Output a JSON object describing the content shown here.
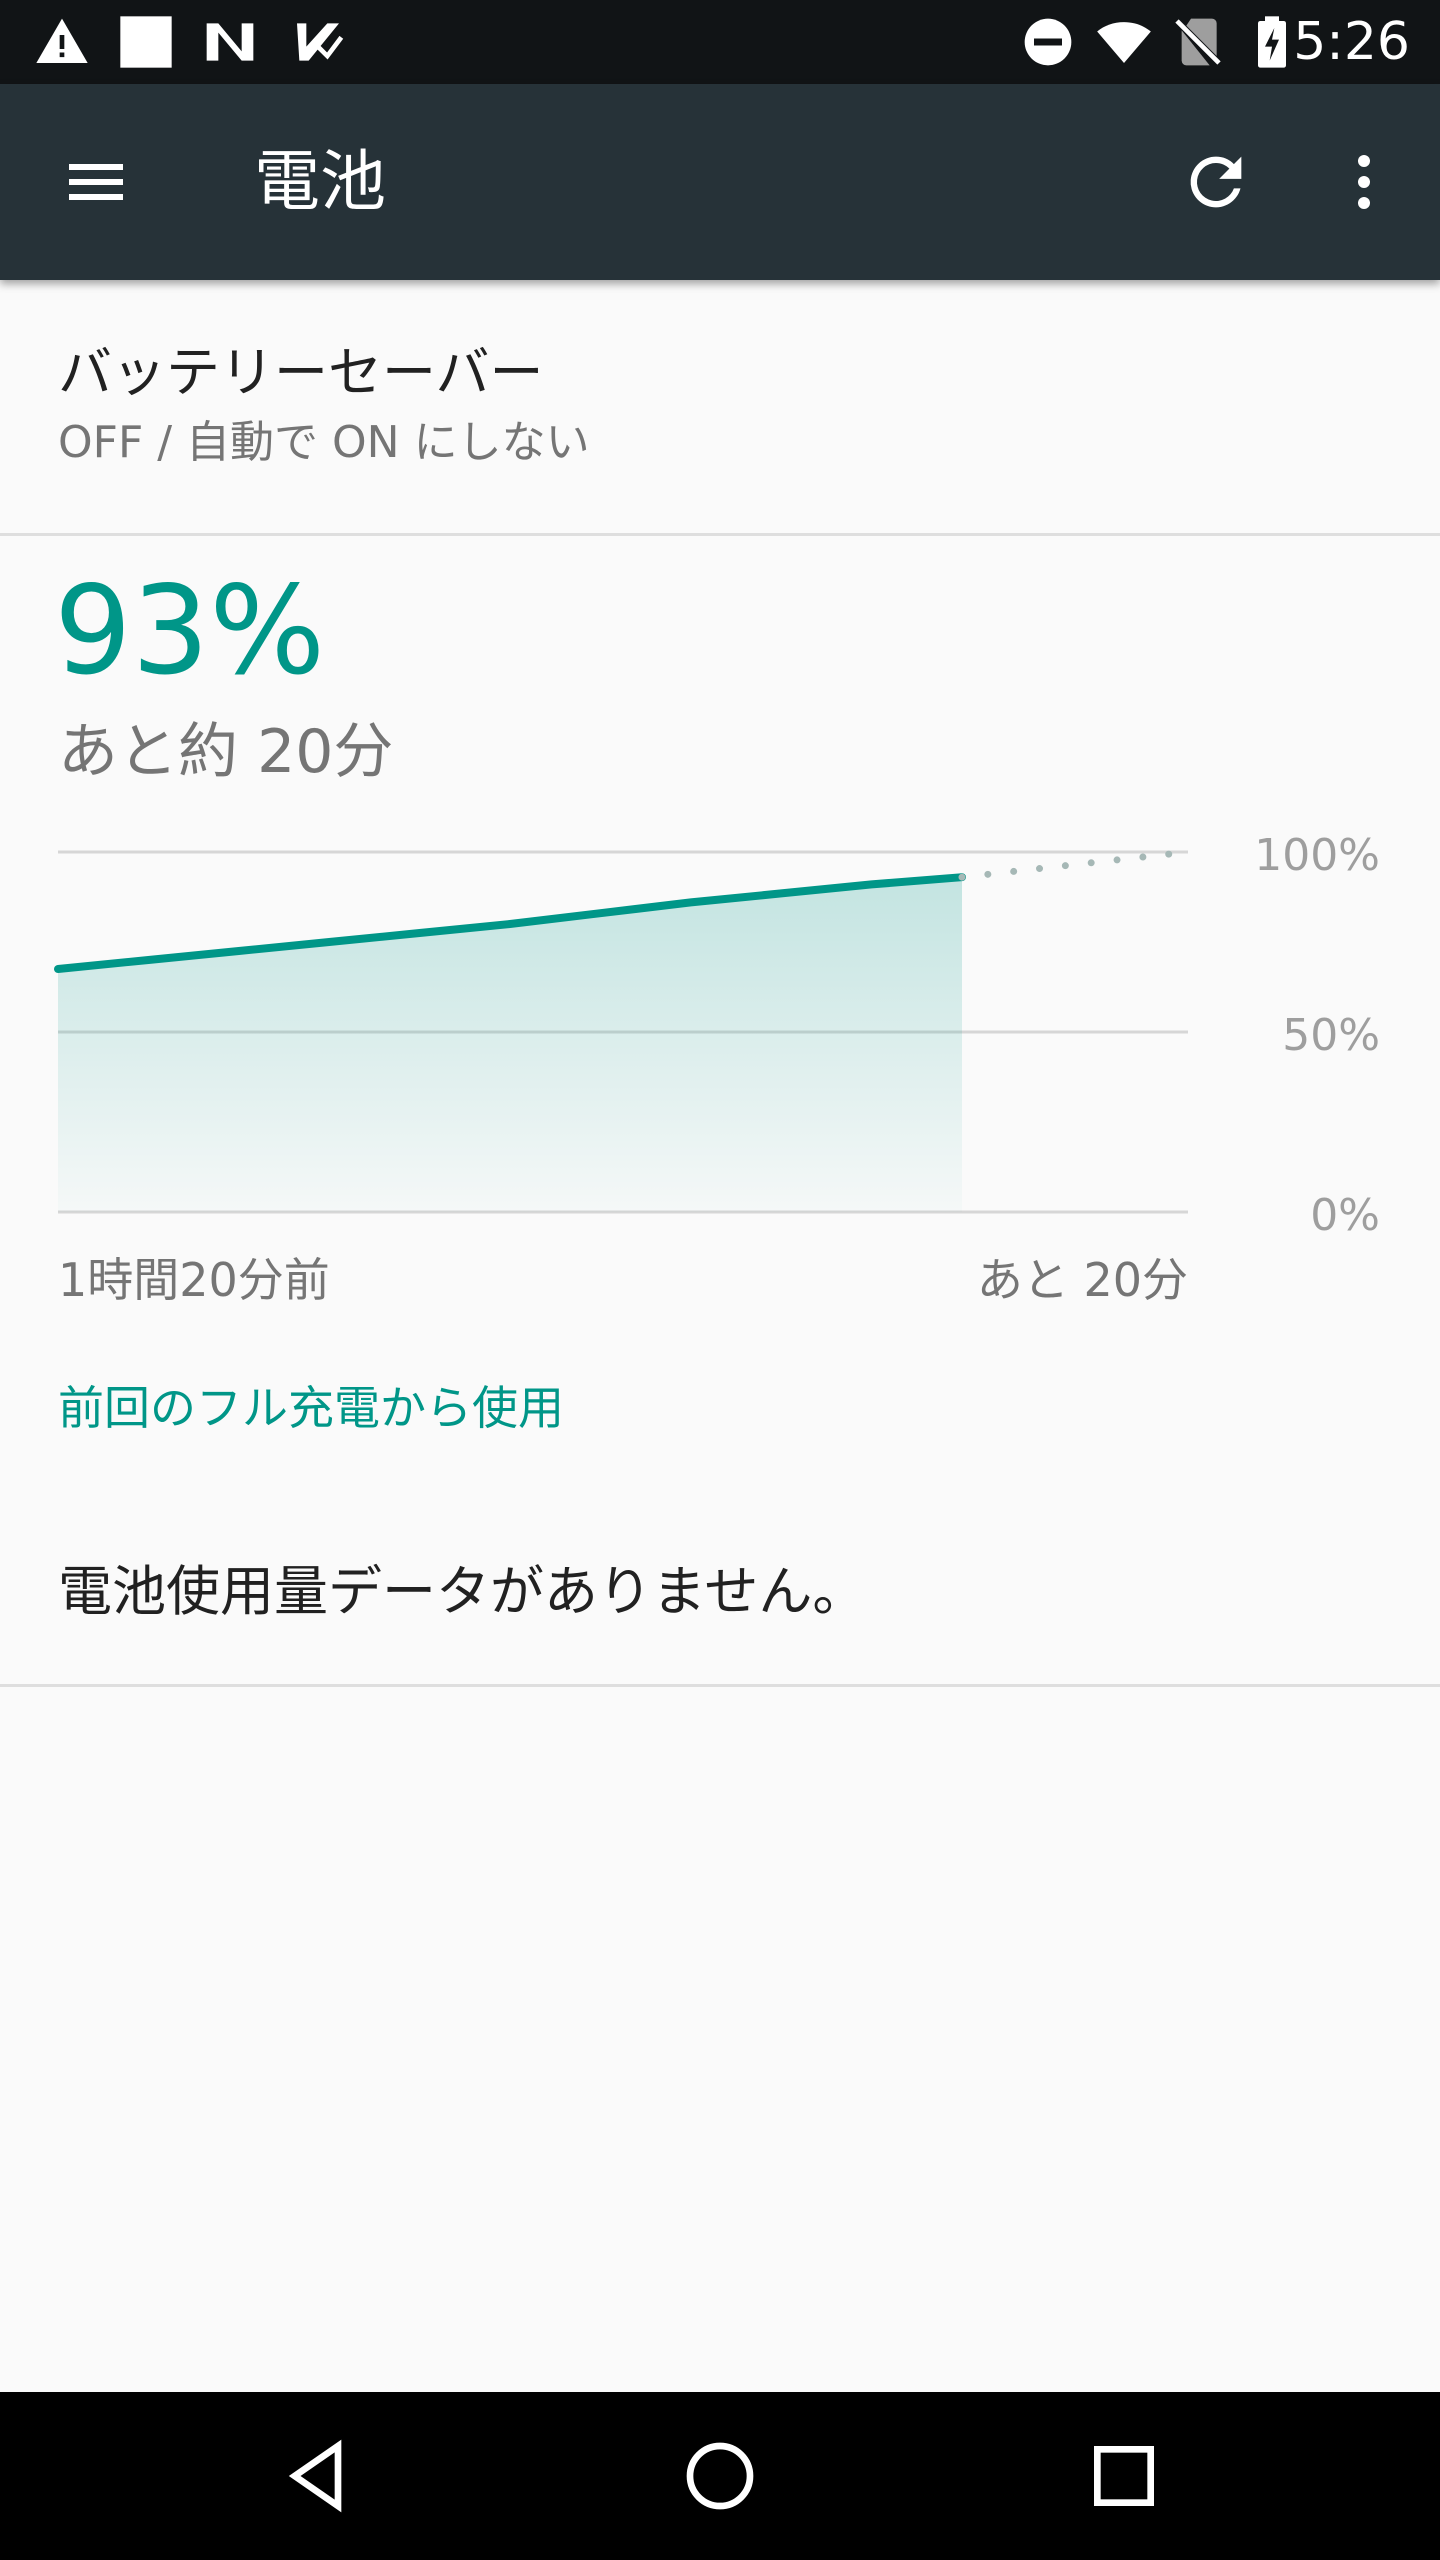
{
  "status_bar": {
    "time": "5:26",
    "left_icons": [
      "warning-icon",
      "blank-notification-icon",
      "n-notification-icon",
      "task-check-icon"
    ],
    "right_icons": [
      "do-not-disturb-icon",
      "wifi-icon",
      "no-sim-icon",
      "battery-charging-icon"
    ]
  },
  "app_bar": {
    "title": "電池",
    "menu_icon": "menu-icon",
    "refresh_icon": "refresh-icon",
    "overflow_icon": "more-vert-icon",
    "background": "#263238"
  },
  "battery_saver": {
    "title": "バッテリーセーバー",
    "subtitle": "OFF / 自動で ON にしない"
  },
  "battery_status": {
    "percent": "93%",
    "remaining": "あと約 20分",
    "accent": "#009688"
  },
  "chart_data": {
    "type": "area",
    "y_tick_labels": [
      "100%",
      "50%",
      "0%"
    ],
    "ylim": [
      0,
      100
    ],
    "x_start_label": "1時間20分前",
    "x_end_label": "あと 20分",
    "x_unit": "minutes relative to now",
    "x_range": [
      -80,
      20
    ],
    "series": [
      {
        "values_x": [
          -80,
          -72,
          -64,
          -56,
          -48,
          -40,
          -32,
          -24,
          -16,
          -8,
          0
        ],
        "values_y": [
          67.5,
          70,
          72.5,
          75,
          77.5,
          80,
          83,
          86,
          88.5,
          91,
          93
        ]
      },
      {
        "style": "dotted",
        "values_x": [
          0,
          20
        ],
        "values_y": [
          93,
          100
        ]
      }
    ],
    "grid": true
  },
  "usage": {
    "since_full_charge_link": "前回のフル充電から使用",
    "no_data_message": "電池使用量データがありません。"
  },
  "nav_bar": {
    "back_icon": "back-icon",
    "home_icon": "home-icon",
    "recents_icon": "recents-icon"
  }
}
